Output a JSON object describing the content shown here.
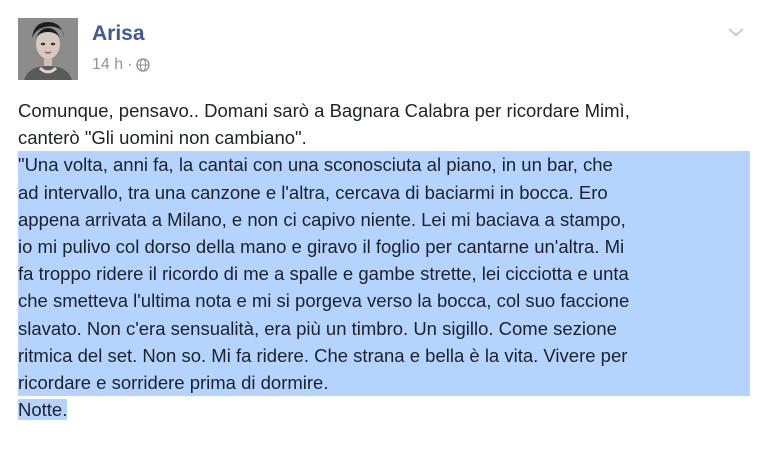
{
  "post": {
    "author": "Arisa",
    "time": "14 h",
    "separator": "·",
    "privacy_icon": "globe-icon",
    "menu_icon": "chevron-down-icon"
  },
  "body_lines": [
    "Comunque, pensavo.. Domani sarò a Bagnara Calabra per ricordare Mimì,",
    "canterò \"Gli uomini non cambiano\".",
    "\"Una volta, anni fa, la cantai con una sconosciuta al piano, in un bar, che",
    "ad intervallo, tra una canzone e l'altra, cercava di baciarmi in bocca. Ero",
    "appena arrivata a Milano, e non ci capivo niente. Lei mi baciava a stampo,",
    "io mi pulivo col dorso della mano e giravo il foglio per cantarne un'altra. Mi",
    "fa troppo ridere il ricordo di me a spalle e gambe strette, lei cicciotta e unta",
    "che smetteva l'ultima nota e mi si porgeva verso la bocca, col suo faccione",
    "slavato. Non c'era sensualità, era più un timbro. Un sigillo. Come sezione",
    "ritmica del set. Non so. Mi fa ridere. Che strana e bella è la vita. Vivere per",
    "ricordare e sorridere prima di dormire.",
    "Notte."
  ],
  "colors": {
    "author": "#3b5998",
    "text": "#1d2129",
    "meta": "#90949c",
    "selection": "#b4d3ff"
  }
}
